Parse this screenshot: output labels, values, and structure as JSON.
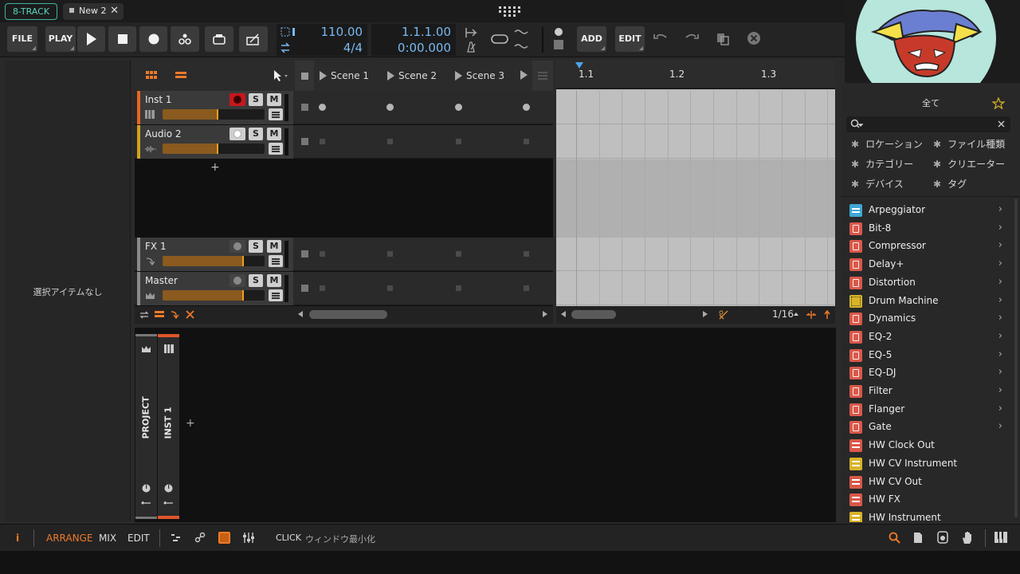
{
  "titlebar": {
    "project_badge": "8-TRACK",
    "tab_label": "New 2",
    "close_glyph": "✕"
  },
  "transport": {
    "file": "FILE",
    "play_menu": "PLAY",
    "tempo": "110.00",
    "signature": "4/4",
    "position_bars": "1.1.1.00",
    "position_time": "0:00.000",
    "add": "ADD",
    "edit": "EDIT"
  },
  "inspector": {
    "empty_label": "選択アイテムなし"
  },
  "launcher": {
    "scenes": [
      "Scene 1",
      "Scene 2",
      "Scene 3"
    ],
    "tracks": [
      {
        "name": "Inst 1",
        "color": "#e8661e",
        "armed": true,
        "volume": 0.55
      },
      {
        "name": "Audio 2",
        "color": "#d1a21c",
        "armed": false,
        "volume": 0.55
      },
      {
        "name": "FX 1",
        "color": "#8a8a8a",
        "armed": false,
        "volume": 0.8
      },
      {
        "name": "Master",
        "color": "#8a8a8a",
        "armed": false,
        "volume": 0.8
      }
    ],
    "add_track": "+",
    "solo": "S",
    "mute": "M"
  },
  "arranger": {
    "ruler_ticks": [
      "1.1",
      "1.2",
      "1.3"
    ],
    "grid_value": "1/16"
  },
  "detail": {
    "project_label": "PROJECT",
    "track_label": "INST 1",
    "add": "+"
  },
  "browser": {
    "header": "全て",
    "filters": [
      "ロケーション",
      "ファイル種類",
      "カテゴリー",
      "クリエーター",
      "デバイス",
      "タグ"
    ],
    "items": [
      {
        "label": "Arpeggiator",
        "icon_color": "#3fa7d6",
        "icon": "note-fx-icon"
      },
      {
        "label": "Bit-8",
        "icon_color": "#d9584a",
        "icon": "audio-fx-icon"
      },
      {
        "label": "Compressor",
        "icon_color": "#d9584a",
        "icon": "audio-fx-icon"
      },
      {
        "label": "Delay+",
        "icon_color": "#d9584a",
        "icon": "audio-fx-icon"
      },
      {
        "label": "Distortion",
        "icon_color": "#d9584a",
        "icon": "audio-fx-icon"
      },
      {
        "label": "Drum Machine",
        "icon_color": "#d8b32a",
        "icon": "drum-grid-icon"
      },
      {
        "label": "Dynamics",
        "icon_color": "#d9584a",
        "icon": "audio-fx-icon"
      },
      {
        "label": "EQ-2",
        "icon_color": "#d9584a",
        "icon": "audio-fx-icon"
      },
      {
        "label": "EQ-5",
        "icon_color": "#d9584a",
        "icon": "audio-fx-icon"
      },
      {
        "label": "EQ-DJ",
        "icon_color": "#d9584a",
        "icon": "audio-fx-icon"
      },
      {
        "label": "Filter",
        "icon_color": "#d9584a",
        "icon": "audio-fx-icon"
      },
      {
        "label": "Flanger",
        "icon_color": "#d9584a",
        "icon": "audio-fx-icon"
      },
      {
        "label": "Gate",
        "icon_color": "#d9584a",
        "icon": "audio-fx-icon"
      },
      {
        "label": "HW Clock Out",
        "icon_color": "#d9584a",
        "icon": "hardware-icon"
      },
      {
        "label": "HW CV Instrument",
        "icon_color": "#d8b32a",
        "icon": "hardware-icon"
      },
      {
        "label": "HW CV Out",
        "icon_color": "#d9584a",
        "icon": "hardware-icon"
      },
      {
        "label": "HW FX",
        "icon_color": "#d9584a",
        "icon": "hardware-icon"
      },
      {
        "label": "HW Instrument",
        "icon_color": "#d8b32a",
        "icon": "hardware-icon"
      }
    ]
  },
  "statusbar": {
    "info": "i",
    "arrange": "ARRANGE",
    "mix": "MIX",
    "edit": "EDIT",
    "hint_key": "CLICK",
    "hint_text": "ウィンドウ最小化"
  },
  "colors": {
    "accent": "#f07a28",
    "display_blue": "#79b8f2",
    "teal": "#59d4bd"
  }
}
